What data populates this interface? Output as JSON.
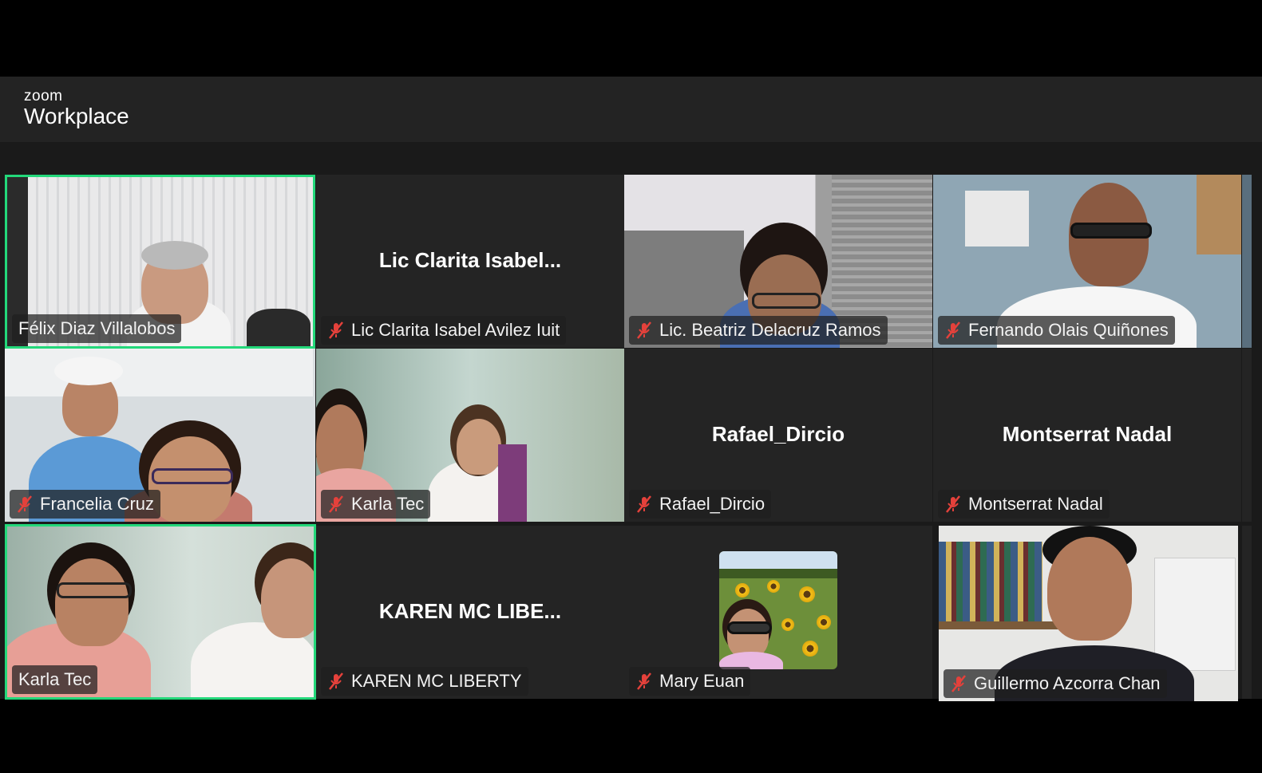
{
  "app": {
    "brand_small": "zoom",
    "brand_big": "Workplace"
  },
  "colors": {
    "active_speaker": "#23d87a",
    "mute": "#e5413b",
    "tile_bg": "#242424"
  },
  "tiles": [
    {
      "id": "felix",
      "name": "Félix Diaz Villalobos",
      "muted": false,
      "video": true,
      "active": true
    },
    {
      "id": "clarita",
      "name": "Lic Clarita Isabel Avilez Iuit",
      "center": "Lic  Clarita  Isabel...",
      "muted": true,
      "video": false
    },
    {
      "id": "beatriz",
      "name": "Lic. Beatriz Delacruz Ramos",
      "muted": true,
      "video": true
    },
    {
      "id": "fernando",
      "name": "Fernando Olais Quiñones",
      "muted": true,
      "video": true
    },
    {
      "id": "francelia",
      "name": "Francelia Cruz",
      "muted": true,
      "video": true
    },
    {
      "id": "karla1",
      "name": "Karla Tec",
      "muted": true,
      "video": true
    },
    {
      "id": "rafael",
      "name": "Rafael_Dircio",
      "center": "Rafael_Dircio",
      "muted": true,
      "video": false
    },
    {
      "id": "montserrat",
      "name": "Montserrat Nadal",
      "center": "Montserrat Nadal",
      "muted": true,
      "video": false
    },
    {
      "id": "karla2",
      "name": "Karla Tec",
      "muted": false,
      "video": true,
      "active": true
    },
    {
      "id": "karen",
      "name": "KAREN MC LIBERTY",
      "center": "KAREN  MC  LIBE...",
      "muted": true,
      "video": false
    },
    {
      "id": "mary",
      "name": "Mary Euan",
      "muted": true,
      "video": false,
      "avatar": "sunflower-photo"
    },
    {
      "id": "guillermo",
      "name": "Guillermo Azcorra Chan",
      "muted": true,
      "video": true
    }
  ]
}
